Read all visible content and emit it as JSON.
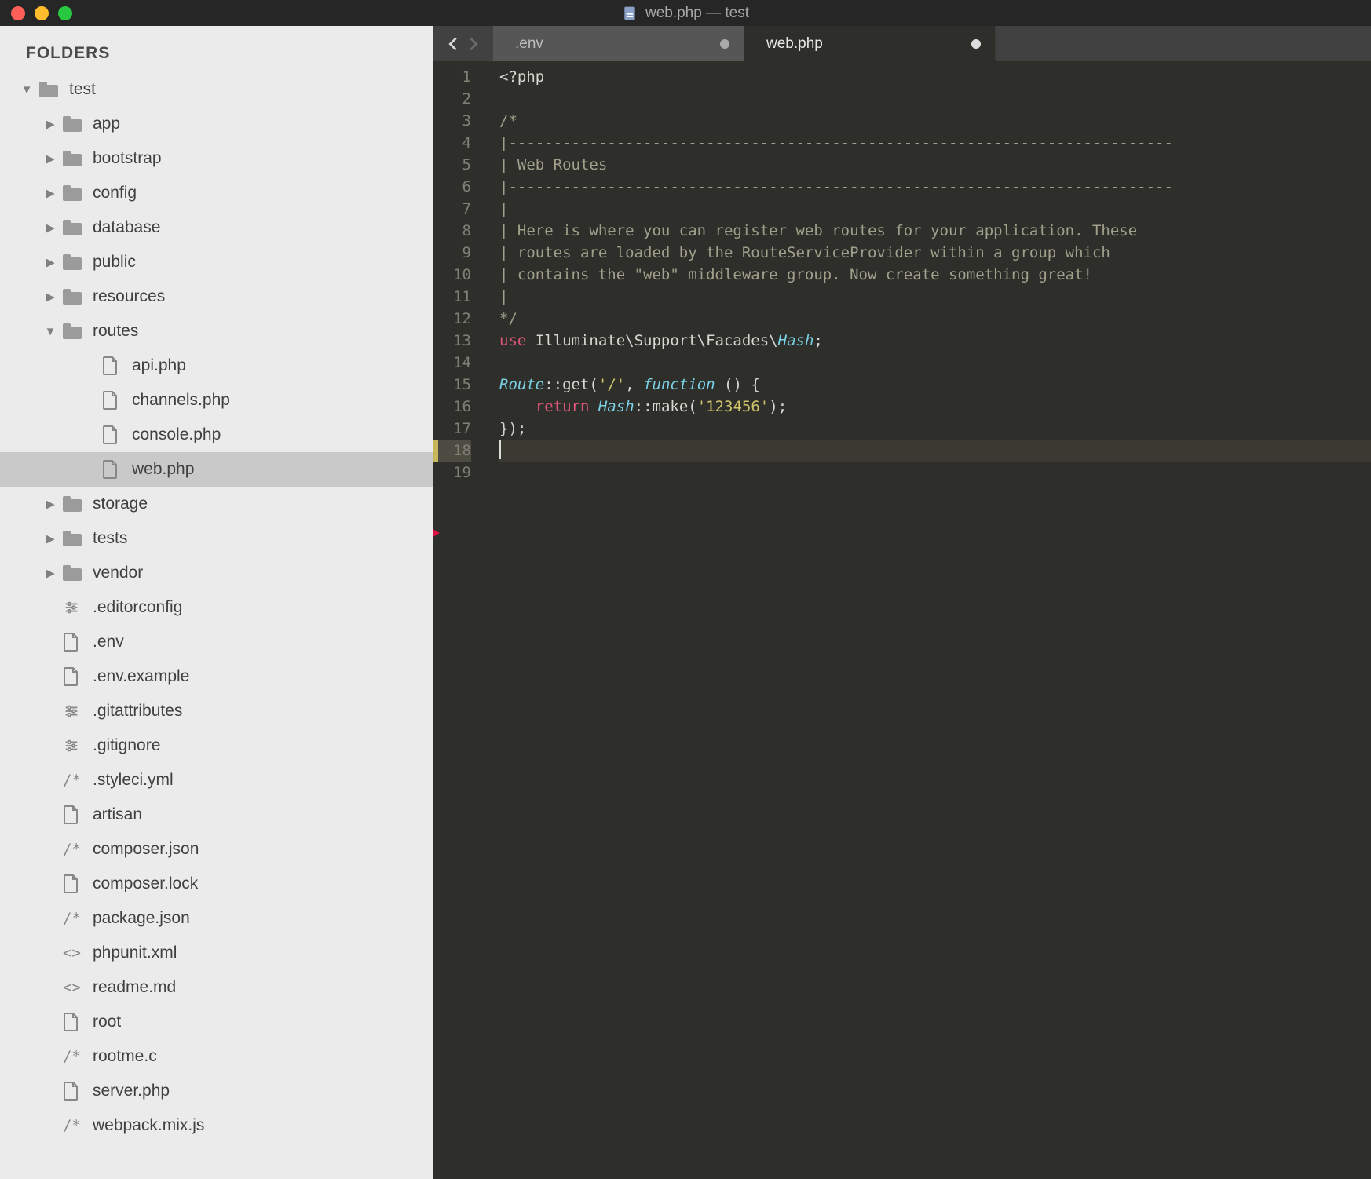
{
  "window": {
    "title": "web.php — test"
  },
  "sidebar": {
    "header": "FOLDERS",
    "tree": [
      {
        "label": "test",
        "type": "folder",
        "depth": 0,
        "expanded": true
      },
      {
        "label": "app",
        "type": "folder",
        "depth": 1,
        "expanded": false
      },
      {
        "label": "bootstrap",
        "type": "folder",
        "depth": 1,
        "expanded": false
      },
      {
        "label": "config",
        "type": "folder",
        "depth": 1,
        "expanded": false
      },
      {
        "label": "database",
        "type": "folder",
        "depth": 1,
        "expanded": false
      },
      {
        "label": "public",
        "type": "folder",
        "depth": 1,
        "expanded": false
      },
      {
        "label": "resources",
        "type": "folder",
        "depth": 1,
        "expanded": false
      },
      {
        "label": "routes",
        "type": "folder",
        "depth": 1,
        "expanded": true
      },
      {
        "label": "api.php",
        "type": "file",
        "depth": 2,
        "icon": "file"
      },
      {
        "label": "channels.php",
        "type": "file",
        "depth": 2,
        "icon": "file"
      },
      {
        "label": "console.php",
        "type": "file",
        "depth": 2,
        "icon": "file"
      },
      {
        "label": "web.php",
        "type": "file",
        "depth": 2,
        "icon": "file",
        "selected": true
      },
      {
        "label": "storage",
        "type": "folder",
        "depth": 1,
        "expanded": false
      },
      {
        "label": "tests",
        "type": "folder",
        "depth": 1,
        "expanded": false
      },
      {
        "label": "vendor",
        "type": "folder",
        "depth": 1,
        "expanded": false
      },
      {
        "label": ".editorconfig",
        "type": "file",
        "depth": 1,
        "icon": "settings"
      },
      {
        "label": ".env",
        "type": "file",
        "depth": 1,
        "icon": "file"
      },
      {
        "label": ".env.example",
        "type": "file",
        "depth": 1,
        "icon": "file"
      },
      {
        "label": ".gitattributes",
        "type": "file",
        "depth": 1,
        "icon": "settings"
      },
      {
        "label": ".gitignore",
        "type": "file",
        "depth": 1,
        "icon": "settings"
      },
      {
        "label": ".styleci.yml",
        "type": "file",
        "depth": 1,
        "icon": "comment"
      },
      {
        "label": "artisan",
        "type": "file",
        "depth": 1,
        "icon": "file"
      },
      {
        "label": "composer.json",
        "type": "file",
        "depth": 1,
        "icon": "comment"
      },
      {
        "label": "composer.lock",
        "type": "file",
        "depth": 1,
        "icon": "file"
      },
      {
        "label": "package.json",
        "type": "file",
        "depth": 1,
        "icon": "comment"
      },
      {
        "label": "phpunit.xml",
        "type": "file",
        "depth": 1,
        "icon": "code"
      },
      {
        "label": "readme.md",
        "type": "file",
        "depth": 1,
        "icon": "code"
      },
      {
        "label": "root",
        "type": "file",
        "depth": 1,
        "icon": "file"
      },
      {
        "label": "rootme.c",
        "type": "file",
        "depth": 1,
        "icon": "comment"
      },
      {
        "label": "server.php",
        "type": "file",
        "depth": 1,
        "icon": "file"
      },
      {
        "label": "webpack.mix.js",
        "type": "file",
        "depth": 1,
        "icon": "comment"
      }
    ]
  },
  "tabs": [
    {
      "label": ".env",
      "active": false,
      "dirty": true
    },
    {
      "label": "web.php",
      "active": true,
      "dirty": true
    }
  ],
  "editor": {
    "current_line": 18,
    "line_count": 19,
    "lines": [
      [
        {
          "c": "c-default",
          "t": "<?php"
        }
      ],
      [],
      [
        {
          "c": "c-comment",
          "t": "/*"
        }
      ],
      [
        {
          "c": "c-comment",
          "t": "|--------------------------------------------------------------------------"
        }
      ],
      [
        {
          "c": "c-comment",
          "t": "| Web Routes"
        }
      ],
      [
        {
          "c": "c-comment",
          "t": "|--------------------------------------------------------------------------"
        }
      ],
      [
        {
          "c": "c-comment",
          "t": "|"
        }
      ],
      [
        {
          "c": "c-comment",
          "t": "| Here is where you can register web routes for your application. These"
        }
      ],
      [
        {
          "c": "c-comment",
          "t": "| routes are loaded by the RouteServiceProvider within a group which"
        }
      ],
      [
        {
          "c": "c-comment",
          "t": "| contains the \"web\" middleware group. Now create something great!"
        }
      ],
      [
        {
          "c": "c-comment",
          "t": "|"
        }
      ],
      [
        {
          "c": "c-comment",
          "t": "*/"
        }
      ],
      [
        {
          "c": "c-keyword",
          "t": "use"
        },
        {
          "c": "c-default",
          "t": " Illuminate\\Support\\Facades\\"
        },
        {
          "c": "c-type",
          "t": "Hash"
        },
        {
          "c": "c-punc",
          "t": ";"
        }
      ],
      [],
      [
        {
          "c": "c-type",
          "t": "Route"
        },
        {
          "c": "c-punc",
          "t": "::"
        },
        {
          "c": "c-method",
          "t": "get"
        },
        {
          "c": "c-punc",
          "t": "("
        },
        {
          "c": "c-string",
          "t": "'/'"
        },
        {
          "c": "c-punc",
          "t": ", "
        },
        {
          "c": "c-type",
          "t": "function"
        },
        {
          "c": "c-punc",
          "t": " () {"
        }
      ],
      [
        {
          "c": "c-comment",
          "t": "    "
        },
        {
          "c": "c-return",
          "t": "return"
        },
        {
          "c": "c-default",
          "t": " "
        },
        {
          "c": "c-type",
          "t": "Hash"
        },
        {
          "c": "c-punc",
          "t": "::"
        },
        {
          "c": "c-method",
          "t": "make"
        },
        {
          "c": "c-punc",
          "t": "("
        },
        {
          "c": "c-string",
          "t": "'123456'"
        },
        {
          "c": "c-punc",
          "t": ");"
        }
      ],
      [
        {
          "c": "c-punc",
          "t": "});"
        }
      ],
      [
        {
          "c": "cursor",
          "t": ""
        }
      ],
      []
    ]
  }
}
